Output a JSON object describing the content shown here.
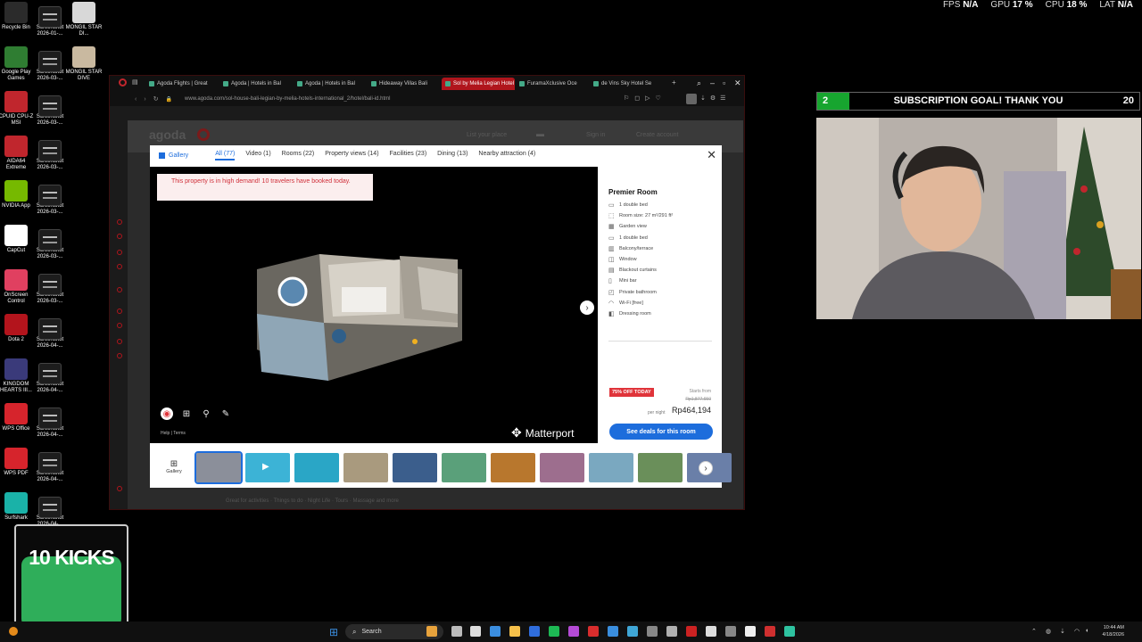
{
  "perf": {
    "fps_label": "FPS",
    "fps_value": "N/A",
    "gpu_label": "GPU",
    "gpu_value": "17 %",
    "cpu_label": "CPU",
    "cpu_value": "18 %",
    "lat_label": "LAT",
    "lat_value": "N/A"
  },
  "desktop_icons": [
    {
      "label": "Recycle Bin",
      "color": "#2b2b2b"
    },
    {
      "label": "Screenshot 2026-01-...",
      "color": "thumb"
    },
    {
      "label": "MONGIL STAR DI...",
      "color": "#d8d8d8"
    },
    {
      "label": "Google Play Games",
      "color": "#2f7d32"
    },
    {
      "label": "Screenshot 2026-03-...",
      "color": "thumb"
    },
    {
      "label": "MONGIL STAR DIVE",
      "color": "#c9b9a0"
    },
    {
      "label": "CPUID CPU-Z MSI",
      "color": "#c0262d"
    },
    {
      "label": "Screenshot 2026-03-...",
      "color": "thumb"
    },
    {
      "label": "AIDA64 Extreme",
      "color": "#c0262d"
    },
    {
      "label": "Screenshot 2026-03-...",
      "color": "thumb"
    },
    {
      "label": "NVIDIA App",
      "color": "#76b900"
    },
    {
      "label": "Screenshot 2026-03-...",
      "color": "thumb"
    },
    {
      "label": "CapCut",
      "color": "#ffffff"
    },
    {
      "label": "Screenshot 2026-03-...",
      "color": "thumb"
    },
    {
      "label": "OnScreen Control",
      "color": "#e04060"
    },
    {
      "label": "Screenshot 2026-03-...",
      "color": "thumb"
    },
    {
      "label": "Dota 2",
      "color": "#b3141c"
    },
    {
      "label": "Screenshot 2026-04-...",
      "color": "thumb"
    },
    {
      "label": "KINGDOM HEARTS III...",
      "color": "#3a3a7a"
    },
    {
      "label": "Screenshot 2026-04-...",
      "color": "thumb"
    },
    {
      "label": "WPS Office",
      "color": "#d6242c"
    },
    {
      "label": "Screenshot 2026-04-...",
      "color": "thumb"
    },
    {
      "label": "WPS PDF",
      "color": "#d6242c"
    },
    {
      "label": "Screenshot 2026-04-...",
      "color": "thumb"
    },
    {
      "label": "Surfshark",
      "color": "#1ab2a8"
    },
    {
      "label": "Screenshot 2026-04-...",
      "color": "thumb"
    }
  ],
  "browser": {
    "tabs": [
      {
        "label": "Agoda Flights | Great",
        "active": false
      },
      {
        "label": "Agoda | Hotels in Bal",
        "active": false
      },
      {
        "label": "Agoda | Hotels in Bal",
        "active": false
      },
      {
        "label": "Hideaway Villas Bali",
        "active": false
      },
      {
        "label": "Sol by Melia Legian Hotel (Bali) -",
        "active": true
      },
      {
        "label": "FuramaXclusive Oce",
        "active": false
      },
      {
        "label": "de Vins Sky Hotel Se",
        "active": false
      }
    ],
    "url": "www.agoda.com/sol-house-bali-legian-by-melia-hotels-international_2/hotel/bali-id.html",
    "page": {
      "logo": "agoda",
      "list_place": "List your place",
      "sign_in": "Sign in",
      "create_account": "Create account",
      "footer": "Great for activities · Things to do · Night Life · Tours · Massage and more"
    }
  },
  "modal": {
    "gallery_label": "Gallery",
    "tabs": [
      {
        "label": "All (77)",
        "active": true
      },
      {
        "label": "Video (1)",
        "active": false
      },
      {
        "label": "Rooms (22)",
        "active": false
      },
      {
        "label": "Property views (14)",
        "active": false
      },
      {
        "label": "Facilities (23)",
        "active": false
      },
      {
        "label": "Dining (13)",
        "active": false
      },
      {
        "label": "Nearby attraction (4)",
        "active": false
      }
    ],
    "demand_text": "This property is in high demand! 10 travelers have booked today.",
    "help_text": "Help | Terms",
    "matterport": "Matterport",
    "room": {
      "title": "Premier Room",
      "features": [
        {
          "icon": "bed-icon",
          "text": "1 double bed"
        },
        {
          "icon": "size-icon",
          "text": "Room size: 27 m²/291 ft²"
        },
        {
          "icon": "view-icon",
          "text": "Garden view"
        },
        {
          "icon": "bed-icon",
          "text": "1 double bed"
        },
        {
          "icon": "balcony-icon",
          "text": "Balcony/terrace"
        },
        {
          "icon": "window-icon",
          "text": "Window"
        },
        {
          "icon": "curtain-icon",
          "text": "Blackout curtains"
        },
        {
          "icon": "minibar-icon",
          "text": "Mini bar"
        },
        {
          "icon": "bath-icon",
          "text": "Private bathroom"
        },
        {
          "icon": "wifi-icon",
          "text": "Wi-Fi [free]"
        },
        {
          "icon": "dressing-icon",
          "text": "Dressing room"
        }
      ],
      "discount": "75% OFF TODAY",
      "starts_from": "Starts from",
      "old_price": "Rp1,877,650",
      "per_night": "per night",
      "price": "Rp464,194",
      "cta": "See deals for this room"
    },
    "thumbs_gallery_label": "Gallery",
    "thumb_colors": [
      "#8b8f9a",
      "#3cb3d6",
      "#2aa6c6",
      "#a99a7e",
      "#3b5e8c",
      "#5aa07a",
      "#b8772d",
      "#9d6e8e",
      "#7aa8c0",
      "#6a8f5a",
      "#6a7fa8"
    ]
  },
  "goal": {
    "current": "2",
    "text": "SUBSCRIPTION GOAL! THANK YOU",
    "target": "20",
    "progress": 0.1
  },
  "kicks": {
    "text": "10 KICKS"
  },
  "taskbar": {
    "search": "Search",
    "time": "10:44 AM",
    "date": "4/18/2026",
    "icon_colors": [
      "#e8a33c",
      "#bbbbbb",
      "#dddddd",
      "#3b8ee0",
      "#f5c04a",
      "#2f6ddc",
      "#1db954",
      "#b54bd6",
      "#d92d2d",
      "#3a8ede",
      "#3fa6d6",
      "#888888",
      "#b0b0b0",
      "#c22",
      "#ddd",
      "#888",
      "#eee",
      "#cf2f2f",
      "#2ec2a0"
    ]
  }
}
